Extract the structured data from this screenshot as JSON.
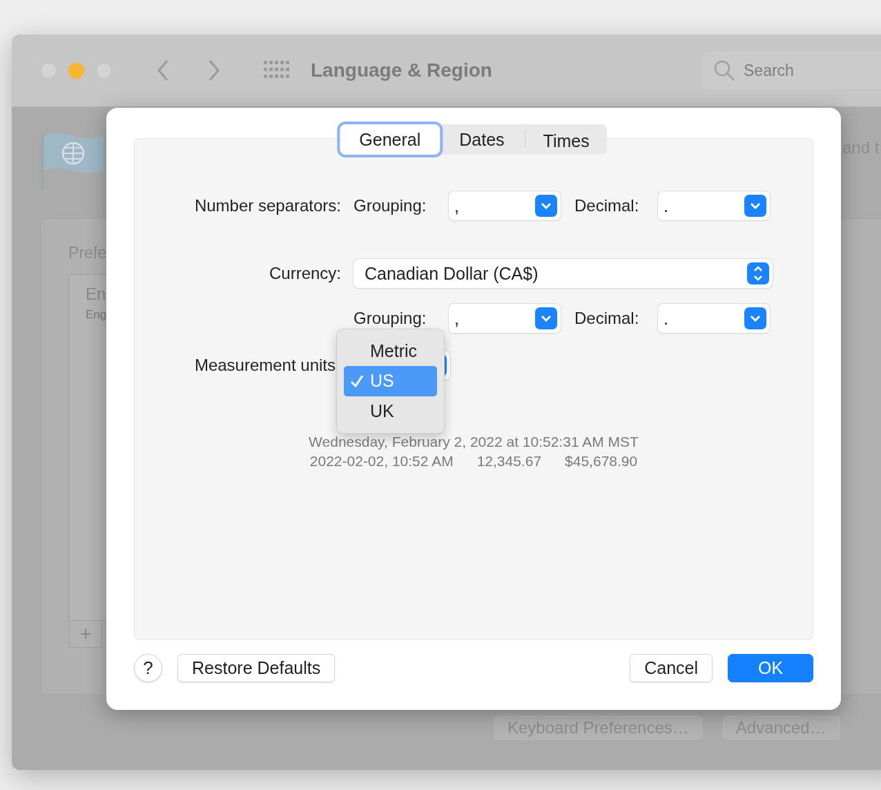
{
  "window": {
    "title": "Language & Region",
    "search": {
      "placeholder": "Search"
    }
  },
  "background": {
    "heading_fragment": "and t",
    "list_title": "Prefe",
    "list_items": [
      {
        "title": "En",
        "subtitle": "Eng"
      }
    ],
    "add_button": "+",
    "buttons": [
      "Keyboard Preferences…",
      "Advanced…"
    ]
  },
  "dialog": {
    "tabs": [
      {
        "label": "General",
        "selected": true
      },
      {
        "label": "Dates",
        "selected": false
      },
      {
        "label": "Times",
        "selected": false
      }
    ],
    "number_separators": {
      "label": "Number separators:",
      "grouping_label": "Grouping:",
      "grouping": ",",
      "decimal_label": "Decimal:",
      "decimal": "."
    },
    "currency": {
      "label": "Currency:",
      "value": "Canadian Dollar (CA$)",
      "grouping_label": "Grouping:",
      "grouping": ",",
      "decimal_label": "Decimal:",
      "decimal": "."
    },
    "measurement": {
      "label": "Measurement units",
      "menu": [
        {
          "label": "Metric",
          "selected": false
        },
        {
          "label": "US",
          "selected": true
        },
        {
          "label": "UK",
          "selected": false
        }
      ]
    },
    "samples": {
      "long_date": "Wednesday, February 2, 2022 at 10:52:31 AM MST",
      "short_date": "2022-02-02, 10:52 AM",
      "number": "12,345.67",
      "currency": "$45,678.90"
    },
    "help_button": "?",
    "buttons": [
      {
        "label": "Restore Defaults",
        "kind": "left",
        "default": false
      },
      {
        "label": "Cancel",
        "kind": "right",
        "default": false
      },
      {
        "label": "OK",
        "kind": "right",
        "default": true
      }
    ]
  }
}
